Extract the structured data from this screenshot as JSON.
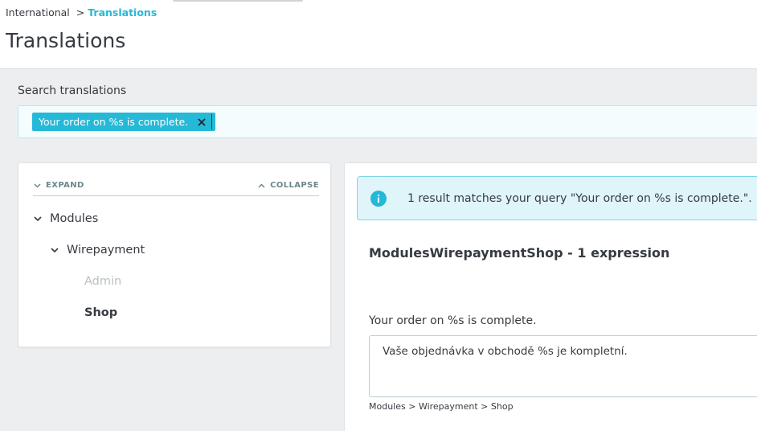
{
  "breadcrumb": {
    "parent": "International",
    "separator": ">",
    "current": "Translations"
  },
  "page_title": "Translations",
  "search": {
    "label": "Search translations",
    "tag": "Your order on %s is complete.",
    "tag_remove_icon": "close-icon"
  },
  "tree": {
    "expand_label": "EXPAND",
    "collapse_label": "COLLAPSE",
    "items": [
      {
        "label": "Modules",
        "state": "expanded"
      },
      {
        "label": "Wirepayment",
        "state": "expanded"
      },
      {
        "label": "Admin",
        "state": "disabled"
      },
      {
        "label": "Shop",
        "state": "selected"
      }
    ]
  },
  "results": {
    "info_icon": "info-icon",
    "message": "1 result matches your query \"Your order on %s is complete.\".",
    "domain_title": "ModulesWirepaymentShop - 1 expression",
    "expression": {
      "source": "Your order on %s is complete.",
      "translation": "Vaše objednávka v obchodě %s je kompletní.",
      "path": "Modules > Wirepayment > Shop"
    }
  },
  "colors": {
    "accent": "#25b9d7",
    "alert_bg": "#dff5f9",
    "alert_border": "#7cd5e7",
    "text": "#363a41",
    "muted": "#b7bfc3",
    "page_bg": "#eceef0"
  }
}
